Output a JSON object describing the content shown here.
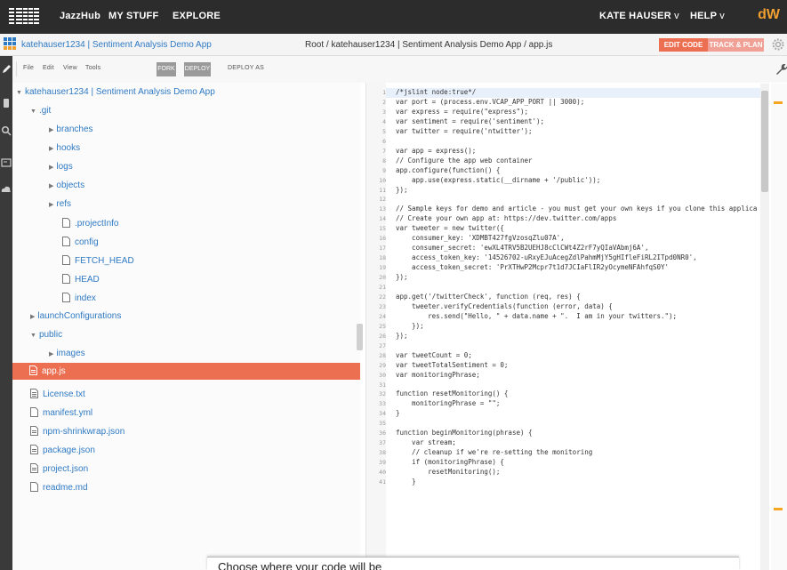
{
  "topnav": {
    "brand": "JazzHub",
    "my_stuff": "MY STUFF",
    "explore": "EXPLORE",
    "user": "KATE HAUSER",
    "help": "HELP",
    "dw": "dW"
  },
  "project": {
    "title": "katehauser1234 | Sentiment Analysis Demo App",
    "breadcrumb": "Root / katehauser1234 | Sentiment Analysis Demo App / app.js",
    "edit_code": "EDIT CODE",
    "track_plan": "TRACK & PLAN"
  },
  "toolbar": {
    "file": "File",
    "edit": "Edit",
    "view": "View",
    "tools": "Tools",
    "fork": "FORK",
    "deploy": "DEPLOY",
    "deploy_as": "DEPLOY AS"
  },
  "tree": {
    "root": "katehauser1234 | Sentiment Analysis Demo App",
    "git": ".git",
    "branches": "branches",
    "hooks": "hooks",
    "logs": "logs",
    "objects": "objects",
    "refs": "refs",
    "projectinfo": ".projectInfo",
    "config": "config",
    "fetch_head": "FETCH_HEAD",
    "head": "HEAD",
    "index": "index",
    "launchconfigurations": "launchConfigurations",
    "public": "public",
    "images": "images",
    "appjs": "app.js",
    "license": "License.txt",
    "manifest": "manifest.yml",
    "shrinkwrap": "npm-shrinkwrap.json",
    "package": "package.json",
    "projectjson": "project.json",
    "readme": "readme.md"
  },
  "editor": {
    "line_numbers": [
      "1",
      "2",
      "3",
      "4",
      "5",
      "6",
      "7",
      "8",
      "9",
      "10",
      "11",
      "12",
      "13",
      "14",
      "15",
      "16",
      "17",
      "18",
      "19",
      "20",
      "21",
      "22",
      "23",
      "24",
      "25",
      "26",
      "27",
      "28",
      "29",
      "30",
      "31",
      "32",
      "33",
      "34",
      "35",
      "36",
      "37",
      "38",
      "39",
      "40",
      "41"
    ],
    "lines": [
      "/*jslint node:true*/",
      "var port = (process.env.VCAP_APP_PORT || 3000);",
      "var express = require(\"express\");",
      "var sentiment = require('sentiment');",
      "var twitter = require('ntwitter');",
      "",
      "var app = express();",
      "// Configure the app web container",
      "app.configure(function() {",
      "    app.use(express.static(__dirname + '/public'));",
      "});",
      "",
      "// Sample keys for demo and article - you must get your own keys if you clone this applica",
      "// Create your own app at: https://dev.twitter.com/apps",
      "var tweeter = new twitter({",
      "    consumer_key: 'XDMBT427fgVzosqZlu07A',",
      "    consumer_secret: 'ewXL4TRV5B2UEHJ8cClCWt4Z2rF7yQIaVAbmj6A',",
      "    access_token_key: '14526702-uRxyEJuAcegZdlPahmMjY5gHIfleFiRL2ITpd0NR0',",
      "    access_token_secret: 'PrXTHwP2Mcpr7t1d7JCIaFlIR2yOcymeNFAhfqS0Y'",
      "});",
      "",
      "app.get('/twitterCheck', function (req, res) {",
      "    tweeter.verifyCredentials(function (error, data) {",
      "        res.send(\"Hello, \" + data.name + \".  I am in your twitters.\");",
      "    });",
      "});",
      "",
      "var tweetCount = 0;",
      "var tweetTotalSentiment = 0;",
      "var monitoringPhrase;",
      "",
      "function resetMonitoring() {",
      "    monitoringPhrase = \"\";",
      "}",
      "",
      "function beginMonitoring(phrase) {",
      "    var stream;",
      "    // cleanup if we're re-setting the monitoring",
      "    if (monitoringPhrase) {",
      "        resetMonitoring();",
      "    }"
    ]
  },
  "popup": {
    "text": "Choose where your code will be"
  }
}
